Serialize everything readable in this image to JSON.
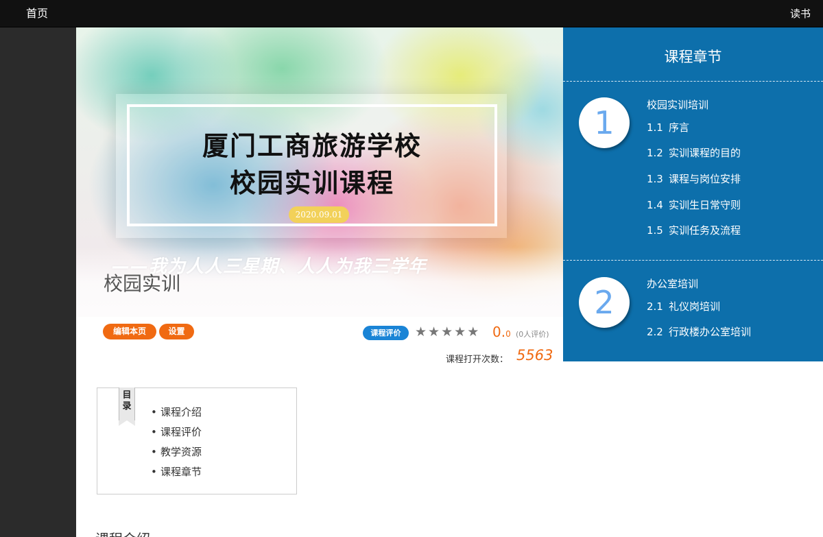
{
  "topbar": {
    "home": "首页",
    "read": "读书"
  },
  "banner": {
    "title_line1": "厦门工商旅游学校",
    "title_line2": "校园实训课程",
    "date": "2020.09.01",
    "slogan": "——我为人人三星期、人人为我三学年",
    "course_name": "校园实训"
  },
  "actions": {
    "edit": "编辑本页",
    "settings": "设置"
  },
  "rating": {
    "badge": "课程评价",
    "stars_total": 5,
    "stars_filled": 0,
    "score_int": "0.",
    "score_dec": "0",
    "count": "(0人评价)",
    "open_label": "课程打开次数：",
    "open_count": "5563"
  },
  "chapters": {
    "title": "课程章节",
    "sections": [
      {
        "number": "1",
        "name": "校园实训培训",
        "items": [
          {
            "num": "1.1",
            "label": "序言"
          },
          {
            "num": "1.2",
            "label": "实训课程的目的"
          },
          {
            "num": "1.3",
            "label": "课程与岗位安排"
          },
          {
            "num": "1.4",
            "label": "实训生日常守则"
          },
          {
            "num": "1.5",
            "label": "实训任务及流程"
          }
        ]
      },
      {
        "number": "2",
        "name": "办公室培训",
        "items": [
          {
            "num": "2.1",
            "label": "礼仪岗培训"
          },
          {
            "num": "2.2",
            "label": "行政楼办公室培训"
          }
        ]
      }
    ]
  },
  "toc": {
    "ribbon": "目录",
    "items": [
      "课程介绍",
      "课程评价",
      "教学资源",
      "课程章节"
    ]
  },
  "intro": {
    "heading": "课程介绍"
  },
  "colors": {
    "accent_blue": "#0d6fab",
    "orange": "#f06a12",
    "badge_blue": "#1a84d6"
  }
}
